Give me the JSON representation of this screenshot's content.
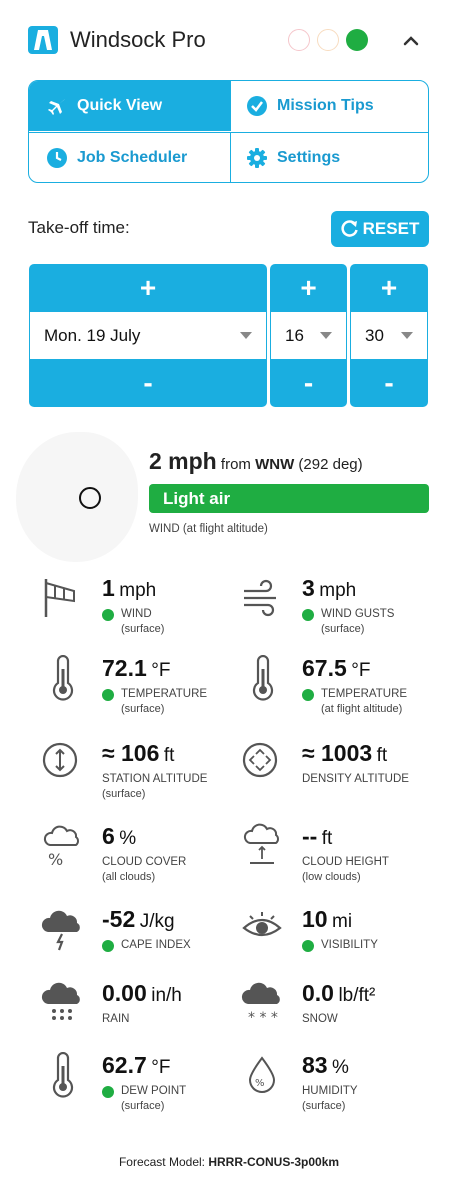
{
  "header": {
    "title": "Windsock Pro",
    "status_dots": [
      "#f5c6cb",
      "#f8dcc0",
      "#1fad42"
    ]
  },
  "nav": {
    "quick_view": "Quick View",
    "mission_tips": "Mission Tips",
    "job_scheduler": "Job Scheduler",
    "settings": "Settings"
  },
  "takeoff": {
    "label": "Take-off time:",
    "reset": "RESET",
    "date": "Mon. 19 July",
    "hour": "16",
    "minute": "30",
    "plus": "+",
    "minus": "-"
  },
  "wind_headline": {
    "speed": "2 mph",
    "from_text": "from",
    "direction": "WNW",
    "degrees": "(292 deg)",
    "category": "Light air",
    "label": "WIND (at flight altitude)"
  },
  "metrics": [
    {
      "value": "1",
      "unit": "mph",
      "label": "WIND",
      "sub": "(surface)",
      "icon": "windsock-icon"
    },
    {
      "value": "3",
      "unit": "mph",
      "label": "WIND GUSTS",
      "sub": "(surface)",
      "icon": "wind-gusts-icon"
    },
    {
      "value": "72.1",
      "unit": "°F",
      "label": "TEMPERATURE",
      "sub": "(surface)",
      "icon": "thermometer-icon"
    },
    {
      "value": "67.5",
      "unit": "°F",
      "label": "TEMPERATURE",
      "sub": "(at flight altitude)",
      "icon": "thermometer-icon"
    },
    {
      "value": "≈ 106",
      "unit": "ft",
      "label": "STATION ALTITUDE",
      "sub": "(surface)",
      "icon": "altitude-icon"
    },
    {
      "value": "≈ 1003",
      "unit": "ft",
      "label": "DENSITY ALTITUDE",
      "sub": "",
      "icon": "density-altitude-icon"
    },
    {
      "value": "6",
      "unit": "%",
      "label": "CLOUD COVER",
      "sub": "(all clouds)",
      "icon": "cloud-cover-icon"
    },
    {
      "value": "--",
      "unit": "ft",
      "label": "CLOUD HEIGHT",
      "sub": "(low clouds)",
      "icon": "cloud-height-icon"
    },
    {
      "value": "-52",
      "unit": "J/kg",
      "label": "CAPE INDEX",
      "sub": "",
      "icon": "storm-icon"
    },
    {
      "value": "10",
      "unit": "mi",
      "label": "VISIBILITY",
      "sub": "",
      "icon": "eye-icon"
    },
    {
      "value": "0.00",
      "unit": "in/h",
      "label": "RAIN",
      "sub": "",
      "icon": "rain-icon"
    },
    {
      "value": "0.0",
      "unit": "lb/ft²",
      "label": "SNOW",
      "sub": "",
      "icon": "snow-icon"
    },
    {
      "value": "62.7",
      "unit": "°F",
      "label": "DEW POINT",
      "sub": "(surface)",
      "icon": "thermometer-icon"
    },
    {
      "value": "83",
      "unit": "%",
      "label": "HUMIDITY",
      "sub": "(surface)",
      "icon": "humidity-icon"
    }
  ],
  "footer": {
    "label": "Forecast Model:",
    "model": "HRRR-CONUS-3p00km"
  }
}
